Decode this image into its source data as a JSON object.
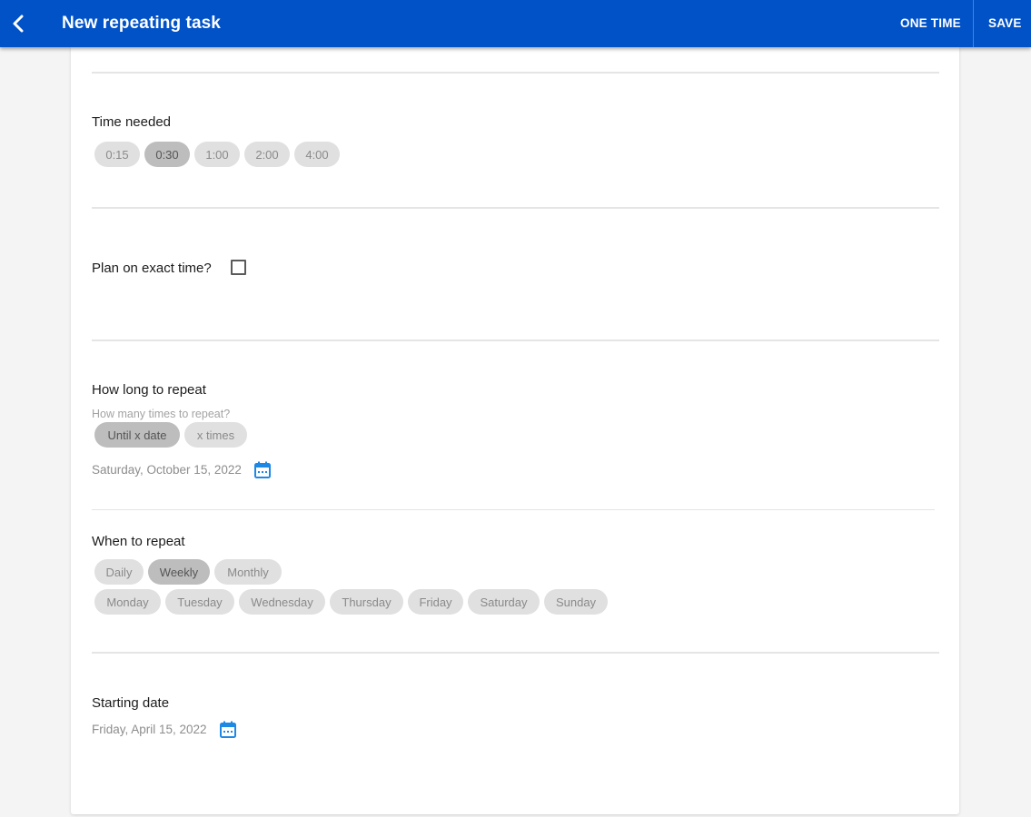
{
  "appbar": {
    "title": "New repeating task",
    "one_time_label": "ONE TIME",
    "save_label": "SAVE",
    "color": "#0152c7"
  },
  "time_needed": {
    "label": "Time needed",
    "options": [
      "0:15",
      "0:30",
      "1:00",
      "2:00",
      "4:00"
    ],
    "selected": "0:30"
  },
  "exact_time": {
    "label": "Plan on exact time?",
    "checked": false
  },
  "repeat_length": {
    "label": "How long to repeat",
    "helper": "How many times to repeat?",
    "options": [
      "Until x date",
      "x times"
    ],
    "selected": "Until x date",
    "end_date": "Saturday, October 15, 2022"
  },
  "repeat_when": {
    "label": "When to repeat",
    "frequency_options": [
      "Daily",
      "Weekly",
      "Monthly"
    ],
    "selected_frequency": "Weekly",
    "days": [
      "Monday",
      "Tuesday",
      "Wednesday",
      "Thursday",
      "Friday",
      "Saturday",
      "Sunday"
    ]
  },
  "starting": {
    "label": "Starting date",
    "date": "Friday, April 15, 2022"
  },
  "icons": {
    "back": "arrow-back-icon",
    "calendar": "calendar-icon",
    "calendar_color": "#1e88e5"
  }
}
